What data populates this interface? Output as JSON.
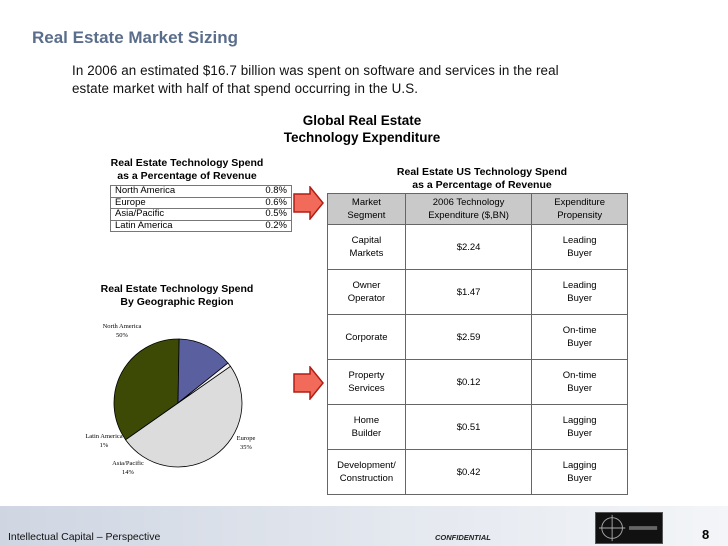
{
  "header": {
    "title": "Real Estate Market Sizing",
    "intro_line1": "In 2006 an estimated $16.7 billion was spent on software and services in the real",
    "intro_line2": "estate market with half of that spend occurring in the U.S."
  },
  "main_heading": {
    "line1": "Global Real Estate",
    "line2": "Technology Expenditure"
  },
  "revenue_table": {
    "title_line1": "Real Estate Technology Spend",
    "title_line2": "as a Percentage of Revenue",
    "rows": [
      {
        "region": "North America",
        "value": "0.8%"
      },
      {
        "region": "Europe",
        "value": "0.6%"
      },
      {
        "region": "Asia/Pacific",
        "value": "0.5%"
      },
      {
        "region": "Latin America",
        "value": "0.2%"
      }
    ]
  },
  "chart_data": {
    "type": "pie",
    "title": "Real Estate Technology Spend By Geographic Region",
    "categories": [
      "North America",
      "Europe",
      "Asia/Pacific",
      "Latin America"
    ],
    "values": [
      50,
      35,
      14,
      1
    ],
    "labels": [
      "50%",
      "35%",
      "14%",
      "1%"
    ],
    "colors": [
      "#dcdcdc",
      "#3c4a06",
      "#5a5fa0",
      "#f2f2f2"
    ]
  },
  "geo_chart": {
    "title_line1": "Real Estate Technology Spend",
    "title_line2": "By Geographic Region"
  },
  "us_table": {
    "title_line1": "Real Estate US Technology Spend",
    "title_line2": "as a Percentage of Revenue",
    "headers": [
      {
        "line1": "Market",
        "line2": "Segment"
      },
      {
        "line1": "2006 Technology",
        "line2": "Expenditure ($,BN)"
      },
      {
        "line1": "Expenditure",
        "line2": "Propensity"
      }
    ],
    "rows": [
      {
        "seg1": "Capital",
        "seg2": "Markets",
        "spend": "$2.24",
        "prop1": "Leading",
        "prop2": "Buyer"
      },
      {
        "seg1": "Owner",
        "seg2": "Operator",
        "spend": "$1.47",
        "prop1": "Leading",
        "prop2": "Buyer"
      },
      {
        "seg1": "Corporate",
        "seg2": "",
        "spend": "$2.59",
        "prop1": "On-time",
        "prop2": "Buyer"
      },
      {
        "seg1": "Property",
        "seg2": "Services",
        "spend": "$0.12",
        "prop1": "On-time",
        "prop2": "Buyer"
      },
      {
        "seg1": "Home",
        "seg2": "Builder",
        "spend": "$0.51",
        "prop1": "Lagging",
        "prop2": "Buyer"
      },
      {
        "seg1": "Development/",
        "seg2": "Construction",
        "spend": "$0.42",
        "prop1": "Lagging",
        "prop2": "Buyer"
      }
    ]
  },
  "footer": {
    "left": "Intellectual Capital – Perspective",
    "confidential": "CONFIDENTIAL",
    "page_number": "8"
  },
  "colors": {
    "title": "#5a6e8c",
    "arrow_fill": "#f26b5a",
    "arrow_stroke": "#b21e14"
  }
}
